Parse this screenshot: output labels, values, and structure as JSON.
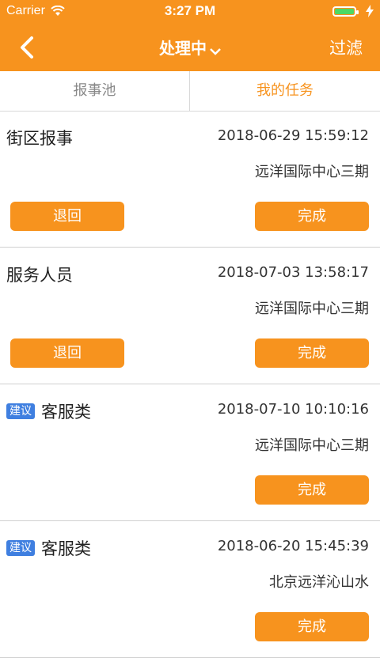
{
  "status_bar": {
    "carrier": "Carrier",
    "time": "3:27 PM"
  },
  "nav": {
    "title": "处理中",
    "filter_label": "过滤"
  },
  "tabs": [
    {
      "label": "报事池",
      "active": false
    },
    {
      "label": "我的任务",
      "active": true
    }
  ],
  "tasks": [
    {
      "title": "街区报事",
      "tag": "",
      "time": "2018-06-29 15:59:12",
      "location": "远洋国际中心三期",
      "return_label": "退回",
      "done_label": "完成"
    },
    {
      "title": "服务人员",
      "tag": "",
      "time": "2018-07-03 13:58:17",
      "location": "远洋国际中心三期",
      "return_label": "退回",
      "done_label": "完成"
    },
    {
      "title": "客服类",
      "tag": "建议",
      "time": "2018-07-10 10:10:16",
      "location": "远洋国际中心三期",
      "done_label": "完成"
    },
    {
      "title": "客服类",
      "tag": "建议",
      "time": "2018-06-20 15:45:39",
      "location": "北京远洋沁山水",
      "done_label": "完成"
    }
  ],
  "colors": {
    "accent": "#f7931e",
    "tag": "#3f7fe0",
    "battery": "#4cd964"
  }
}
